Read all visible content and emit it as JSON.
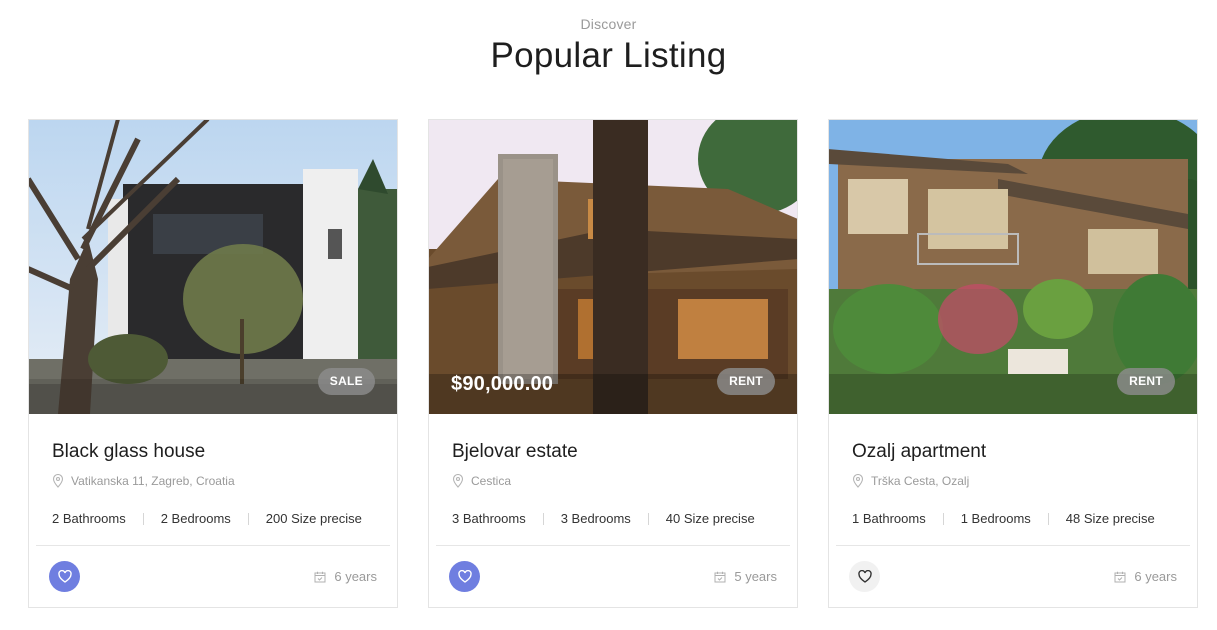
{
  "section": {
    "eyebrow": "Discover",
    "title": "Popular Listing"
  },
  "listings": [
    {
      "name": "Black glass house",
      "address": "Vatikanska 11, Zagreb, Croatia",
      "badge": "SALE",
      "price": "",
      "bathrooms": "2 Bathrooms",
      "bedrooms": "2 Bedrooms",
      "size": "200 Size precise",
      "age": "6 years",
      "favorited": true
    },
    {
      "name": "Bjelovar estate",
      "address": "Cestica",
      "badge": "RENT",
      "price": "$90,000.00",
      "bathrooms": "3 Bathrooms",
      "bedrooms": "3 Bedrooms",
      "size": "40 Size precise",
      "age": "5 years",
      "favorited": true
    },
    {
      "name": "Ozalj apartment",
      "address": "Trška Cesta, Ozalj",
      "badge": "RENT",
      "price": "",
      "bathrooms": "1 Bathrooms",
      "bedrooms": "1 Bedrooms",
      "size": "48 Size precise",
      "age": "6 years",
      "favorited": false
    }
  ],
  "colors": {
    "accent": "#6f7ee0",
    "badge_bg": "#8c8c8c",
    "muted_text": "#9a9a9a"
  },
  "icons": {
    "location": "map-pin-icon",
    "favorite": "heart-icon",
    "calendar": "calendar-icon"
  }
}
